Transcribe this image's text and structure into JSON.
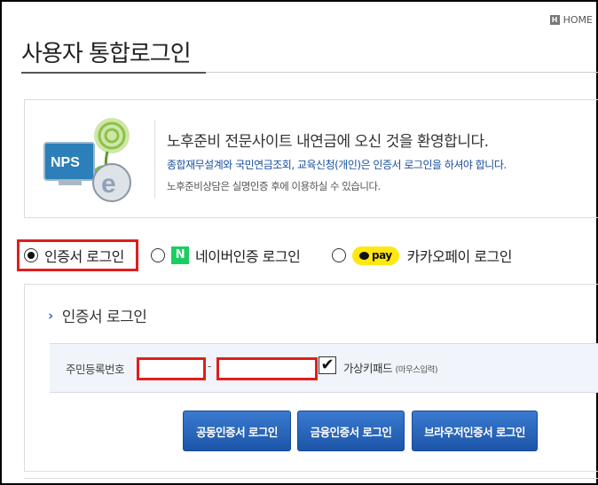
{
  "header": {
    "home_label": "HOME",
    "home_icon": "H",
    "title": "사용자 통합로그인"
  },
  "welcome": {
    "logo_text": "NPS",
    "headline": "노후준비 전문사이트 내연금에 오신 것을 환영합니다.",
    "sub": "종합재무설계와 국민연금조회, 교육신청(개인)은 인증서 로그인을 하셔야 합니다.",
    "note": "노후준비상담은 실명인증 후에 이용하실 수 있습니다."
  },
  "login_options": {
    "cert": "인증서 로그인",
    "naver_badge": "N",
    "naver": "네이버인증 로그인",
    "kakao_badge": "pay",
    "kakao": "카카오페이 로그인",
    "selected": "cert"
  },
  "cert_section": {
    "title": "인증서 로그인",
    "id_label": "주민등록번호",
    "separator": "-",
    "id_front_value": "",
    "id_back_value": "",
    "keypad_checked": true,
    "keypad_label": "가상키패드",
    "keypad_hint": "(마우스입력)",
    "buttons": {
      "public_cert": "공동인증서 로그인",
      "finance_cert": "금융인증서 로그인",
      "browser_cert": "브라우저인증서 로그인"
    }
  },
  "colors": {
    "accent_blue": "#1c55a8",
    "highlight_red": "#e01e1e",
    "naver_green": "#19ce60",
    "kakao_yellow": "#ffe812"
  }
}
